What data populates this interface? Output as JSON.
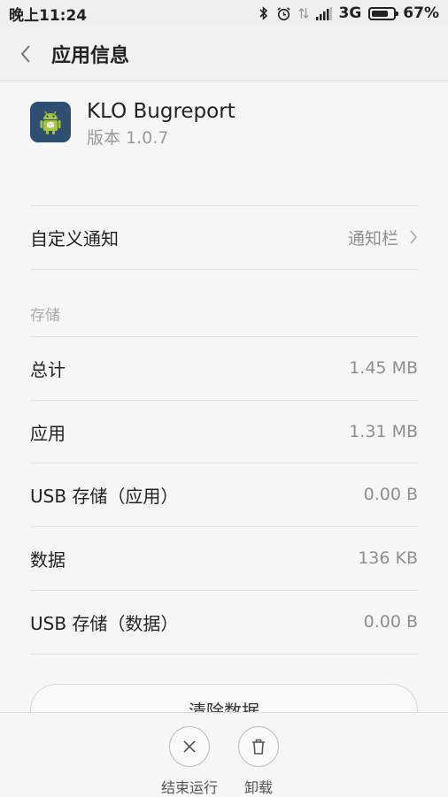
{
  "status_bar": {
    "time": "晚上11:24",
    "network": "3G",
    "battery_percent": "67%",
    "battery_level": 0.67
  },
  "header": {
    "title": "应用信息"
  },
  "app": {
    "name": "KLO Bugreport",
    "version": "版本 1.0.7"
  },
  "notification": {
    "label": "自定义通知",
    "value": "通知栏"
  },
  "storage": {
    "section_label": "存储",
    "rows": [
      {
        "label": "总计",
        "value": "1.45 MB"
      },
      {
        "label": "应用",
        "value": "1.31 MB"
      },
      {
        "label": "USB 存储（应用）",
        "value": "0.00 B"
      },
      {
        "label": "数据",
        "value": "136 KB"
      },
      {
        "label": "USB 存储（数据）",
        "value": "0.00 B"
      }
    ]
  },
  "clear_data_label": "清除数据",
  "bottom_actions": {
    "force_stop": "结束运行",
    "uninstall": "卸载"
  },
  "colors": {
    "background": "#f7f7f7",
    "app_icon_bg": "#2e4e72",
    "android_green": "#a4c639"
  }
}
